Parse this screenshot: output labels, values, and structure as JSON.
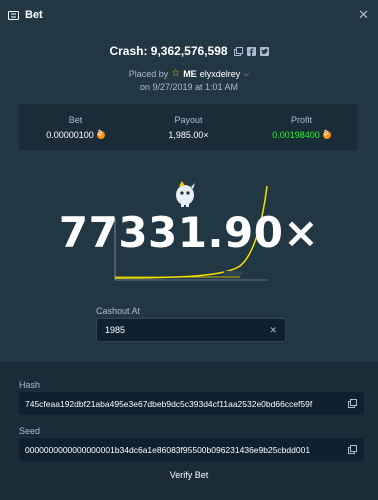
{
  "header": {
    "title": "Bet",
    "close_label": "✕"
  },
  "crash": {
    "text": "Crash: 9,362,576,598"
  },
  "placed": {
    "prefix": "Placed by",
    "badge": "ME",
    "username": "elyxdelrey",
    "date": "on 9/27/2019 at 1:01 AM"
  },
  "stats": {
    "bet": {
      "label": "Bet",
      "value": "0.00000100"
    },
    "payout": {
      "label": "Payout",
      "value": "1,985.00×"
    },
    "profit": {
      "label": "Profit",
      "value": "0.00198400"
    }
  },
  "multiplier": "77331.90×",
  "graph": {
    "badge": "elyxdelrey"
  },
  "cashout": {
    "label": "Cashout At",
    "value": "1985"
  },
  "hash": {
    "label": "Hash",
    "value": "745cfeaa192dbf21aba495e3e67dbeb9dc5c393d4cf11aa2532e0bd66ccef59f"
  },
  "seed": {
    "label": "Seed",
    "value": "0000000000000000001b34dc6a1e86083f95500b096231436e9b25cbdd001"
  },
  "verify_label": "Verify Bet",
  "colors": {
    "background": "#213743",
    "panel": "#1a2c38",
    "input": "#0f212e",
    "profit_green": "#1fff20",
    "curve_yellow": "#f5e100",
    "btc_orange": "#f7931a"
  }
}
